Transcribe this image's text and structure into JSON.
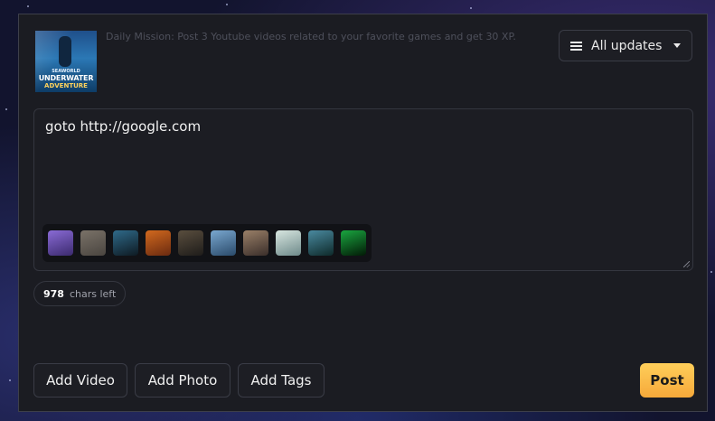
{
  "mission": {
    "text": "Daily Mission: Post 3 Youtube videos related to your favorite games and get 30 XP.",
    "thumbnail": {
      "brand": "SEAWORLD",
      "title_line1": "UNDERWATER",
      "title_line2": "ADVENTURE"
    }
  },
  "filter": {
    "label": "All updates",
    "icon": "menu-icon"
  },
  "composer": {
    "value": "goto http://google.com",
    "game_thumbnails": [
      {
        "name": "game-1",
        "color1": "#3b2a6e",
        "color2": "#8a6bd6"
      },
      {
        "name": "game-2",
        "color1": "#4a4540",
        "color2": "#7a7268"
      },
      {
        "name": "game-3",
        "color1": "#0e1a22",
        "color2": "#2f6a8a"
      },
      {
        "name": "game-4",
        "color1": "#6a2a10",
        "color2": "#d2691e"
      },
      {
        "name": "game-5",
        "color1": "#1e1c1a",
        "color2": "#5a4e3e"
      },
      {
        "name": "game-6",
        "color1": "#2a4a6a",
        "color2": "#7aa8d0"
      },
      {
        "name": "game-7",
        "color1": "#3a2e2a",
        "color2": "#9a8068"
      },
      {
        "name": "game-8",
        "color1": "#6e8a8a",
        "color2": "#d8e6e0"
      },
      {
        "name": "game-9",
        "color1": "#0e2a2a",
        "color2": "#4a8aa0"
      },
      {
        "name": "game-10",
        "color1": "#021a06",
        "color2": "#1aa640"
      }
    ]
  },
  "chars_left": {
    "count": "978",
    "label": "chars left"
  },
  "actions": {
    "add_video": "Add Video",
    "add_photo": "Add Photo",
    "add_tags": "Add Tags",
    "post": "Post"
  },
  "colors": {
    "accent": "#f6a93a",
    "panel": "#1b1c22"
  }
}
